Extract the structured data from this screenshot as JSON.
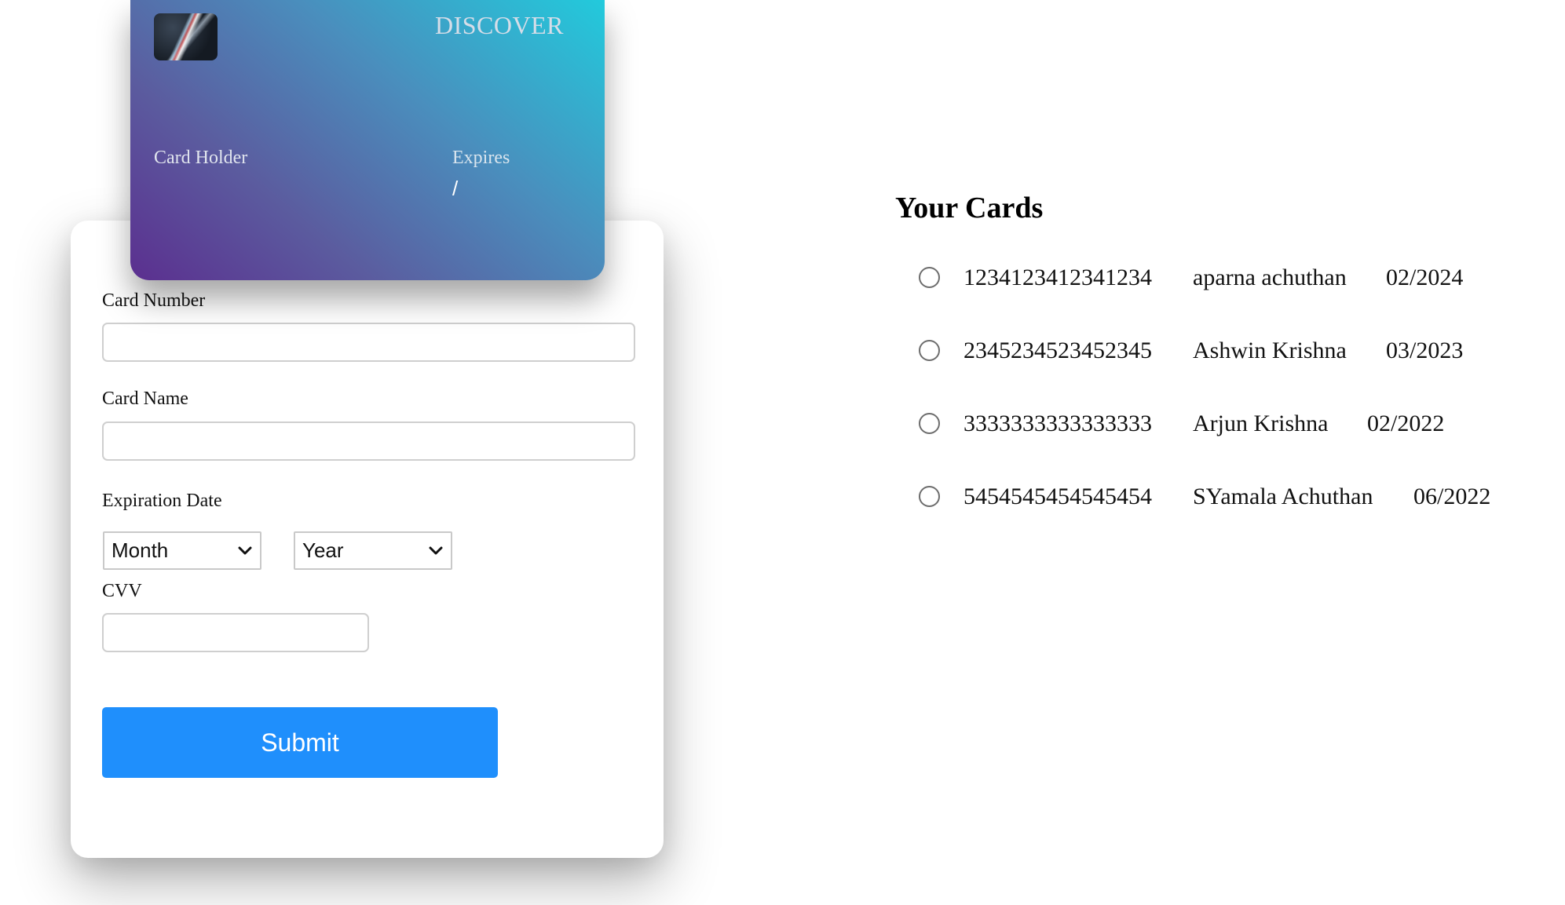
{
  "card_preview": {
    "brand": "DISCOVER",
    "holder_label": "Card Holder",
    "expires_label": "Expires",
    "expires_value": "/"
  },
  "form": {
    "card_number_label": "Card Number",
    "card_number_value": "",
    "card_name_label": "Card Name",
    "card_name_value": "",
    "expiration_label": "Expiration Date",
    "month_selected": "Month",
    "year_selected": "Year",
    "cvv_label": "CVV",
    "cvv_value": "",
    "submit_label": "Submit"
  },
  "saved_cards": {
    "title": "Your Cards",
    "items": [
      {
        "number": "1234123412341234",
        "name": "aparna achuthan",
        "expiry": "02/2024",
        "selected": false
      },
      {
        "number": "2345234523452345",
        "name": "Ashwin Krishna",
        "expiry": "03/2023",
        "selected": false
      },
      {
        "number": "3333333333333333",
        "name": "Arjun Krishna",
        "expiry": "02/2022",
        "selected": false
      },
      {
        "number": "5454545454545454",
        "name": "SYamala Achuthan",
        "expiry": "06/2022",
        "selected": false
      }
    ]
  },
  "colors": {
    "submit_bg": "#1f8ffc",
    "card_gradient_start": "#5b2f8f",
    "card_gradient_end": "#22cadc"
  }
}
